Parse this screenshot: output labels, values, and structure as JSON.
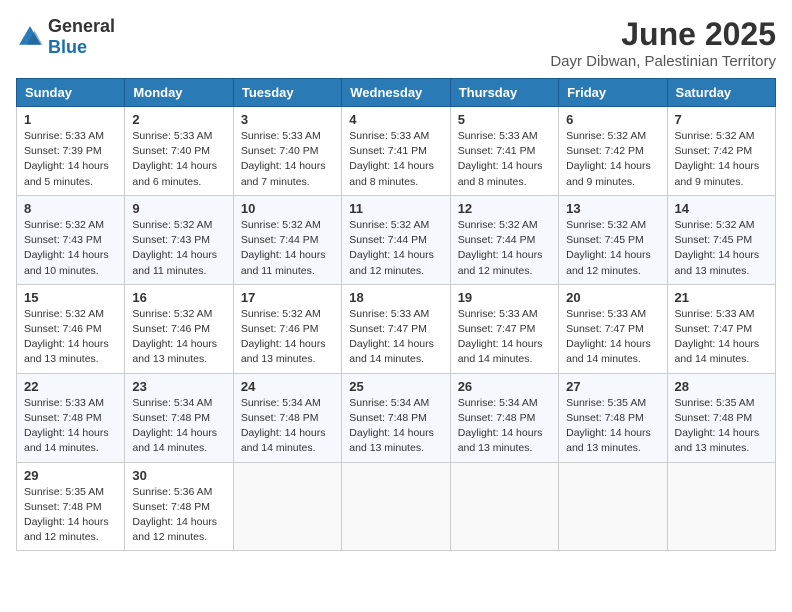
{
  "logo": {
    "general": "General",
    "blue": "Blue"
  },
  "title": "June 2025",
  "location": "Dayr Dibwan, Palestinian Territory",
  "headers": [
    "Sunday",
    "Monday",
    "Tuesday",
    "Wednesday",
    "Thursday",
    "Friday",
    "Saturday"
  ],
  "weeks": [
    [
      {
        "day": "1",
        "sunrise": "Sunrise: 5:33 AM",
        "sunset": "Sunset: 7:39 PM",
        "daylight": "Daylight: 14 hours and 5 minutes."
      },
      {
        "day": "2",
        "sunrise": "Sunrise: 5:33 AM",
        "sunset": "Sunset: 7:40 PM",
        "daylight": "Daylight: 14 hours and 6 minutes."
      },
      {
        "day": "3",
        "sunrise": "Sunrise: 5:33 AM",
        "sunset": "Sunset: 7:40 PM",
        "daylight": "Daylight: 14 hours and 7 minutes."
      },
      {
        "day": "4",
        "sunrise": "Sunrise: 5:33 AM",
        "sunset": "Sunset: 7:41 PM",
        "daylight": "Daylight: 14 hours and 8 minutes."
      },
      {
        "day": "5",
        "sunrise": "Sunrise: 5:33 AM",
        "sunset": "Sunset: 7:41 PM",
        "daylight": "Daylight: 14 hours and 8 minutes."
      },
      {
        "day": "6",
        "sunrise": "Sunrise: 5:32 AM",
        "sunset": "Sunset: 7:42 PM",
        "daylight": "Daylight: 14 hours and 9 minutes."
      },
      {
        "day": "7",
        "sunrise": "Sunrise: 5:32 AM",
        "sunset": "Sunset: 7:42 PM",
        "daylight": "Daylight: 14 hours and 9 minutes."
      }
    ],
    [
      {
        "day": "8",
        "sunrise": "Sunrise: 5:32 AM",
        "sunset": "Sunset: 7:43 PM",
        "daylight": "Daylight: 14 hours and 10 minutes."
      },
      {
        "day": "9",
        "sunrise": "Sunrise: 5:32 AM",
        "sunset": "Sunset: 7:43 PM",
        "daylight": "Daylight: 14 hours and 11 minutes."
      },
      {
        "day": "10",
        "sunrise": "Sunrise: 5:32 AM",
        "sunset": "Sunset: 7:44 PM",
        "daylight": "Daylight: 14 hours and 11 minutes."
      },
      {
        "day": "11",
        "sunrise": "Sunrise: 5:32 AM",
        "sunset": "Sunset: 7:44 PM",
        "daylight": "Daylight: 14 hours and 12 minutes."
      },
      {
        "day": "12",
        "sunrise": "Sunrise: 5:32 AM",
        "sunset": "Sunset: 7:44 PM",
        "daylight": "Daylight: 14 hours and 12 minutes."
      },
      {
        "day": "13",
        "sunrise": "Sunrise: 5:32 AM",
        "sunset": "Sunset: 7:45 PM",
        "daylight": "Daylight: 14 hours and 12 minutes."
      },
      {
        "day": "14",
        "sunrise": "Sunrise: 5:32 AM",
        "sunset": "Sunset: 7:45 PM",
        "daylight": "Daylight: 14 hours and 13 minutes."
      }
    ],
    [
      {
        "day": "15",
        "sunrise": "Sunrise: 5:32 AM",
        "sunset": "Sunset: 7:46 PM",
        "daylight": "Daylight: 14 hours and 13 minutes."
      },
      {
        "day": "16",
        "sunrise": "Sunrise: 5:32 AM",
        "sunset": "Sunset: 7:46 PM",
        "daylight": "Daylight: 14 hours and 13 minutes."
      },
      {
        "day": "17",
        "sunrise": "Sunrise: 5:32 AM",
        "sunset": "Sunset: 7:46 PM",
        "daylight": "Daylight: 14 hours and 13 minutes."
      },
      {
        "day": "18",
        "sunrise": "Sunrise: 5:33 AM",
        "sunset": "Sunset: 7:47 PM",
        "daylight": "Daylight: 14 hours and 14 minutes."
      },
      {
        "day": "19",
        "sunrise": "Sunrise: 5:33 AM",
        "sunset": "Sunset: 7:47 PM",
        "daylight": "Daylight: 14 hours and 14 minutes."
      },
      {
        "day": "20",
        "sunrise": "Sunrise: 5:33 AM",
        "sunset": "Sunset: 7:47 PM",
        "daylight": "Daylight: 14 hours and 14 minutes."
      },
      {
        "day": "21",
        "sunrise": "Sunrise: 5:33 AM",
        "sunset": "Sunset: 7:47 PM",
        "daylight": "Daylight: 14 hours and 14 minutes."
      }
    ],
    [
      {
        "day": "22",
        "sunrise": "Sunrise: 5:33 AM",
        "sunset": "Sunset: 7:48 PM",
        "daylight": "Daylight: 14 hours and 14 minutes."
      },
      {
        "day": "23",
        "sunrise": "Sunrise: 5:34 AM",
        "sunset": "Sunset: 7:48 PM",
        "daylight": "Daylight: 14 hours and 14 minutes."
      },
      {
        "day": "24",
        "sunrise": "Sunrise: 5:34 AM",
        "sunset": "Sunset: 7:48 PM",
        "daylight": "Daylight: 14 hours and 14 minutes."
      },
      {
        "day": "25",
        "sunrise": "Sunrise: 5:34 AM",
        "sunset": "Sunset: 7:48 PM",
        "daylight": "Daylight: 14 hours and 13 minutes."
      },
      {
        "day": "26",
        "sunrise": "Sunrise: 5:34 AM",
        "sunset": "Sunset: 7:48 PM",
        "daylight": "Daylight: 14 hours and 13 minutes."
      },
      {
        "day": "27",
        "sunrise": "Sunrise: 5:35 AM",
        "sunset": "Sunset: 7:48 PM",
        "daylight": "Daylight: 14 hours and 13 minutes."
      },
      {
        "day": "28",
        "sunrise": "Sunrise: 5:35 AM",
        "sunset": "Sunset: 7:48 PM",
        "daylight": "Daylight: 14 hours and 13 minutes."
      }
    ],
    [
      {
        "day": "29",
        "sunrise": "Sunrise: 5:35 AM",
        "sunset": "Sunset: 7:48 PM",
        "daylight": "Daylight: 14 hours and 12 minutes."
      },
      {
        "day": "30",
        "sunrise": "Sunrise: 5:36 AM",
        "sunset": "Sunset: 7:48 PM",
        "daylight": "Daylight: 14 hours and 12 minutes."
      },
      null,
      null,
      null,
      null,
      null
    ]
  ]
}
